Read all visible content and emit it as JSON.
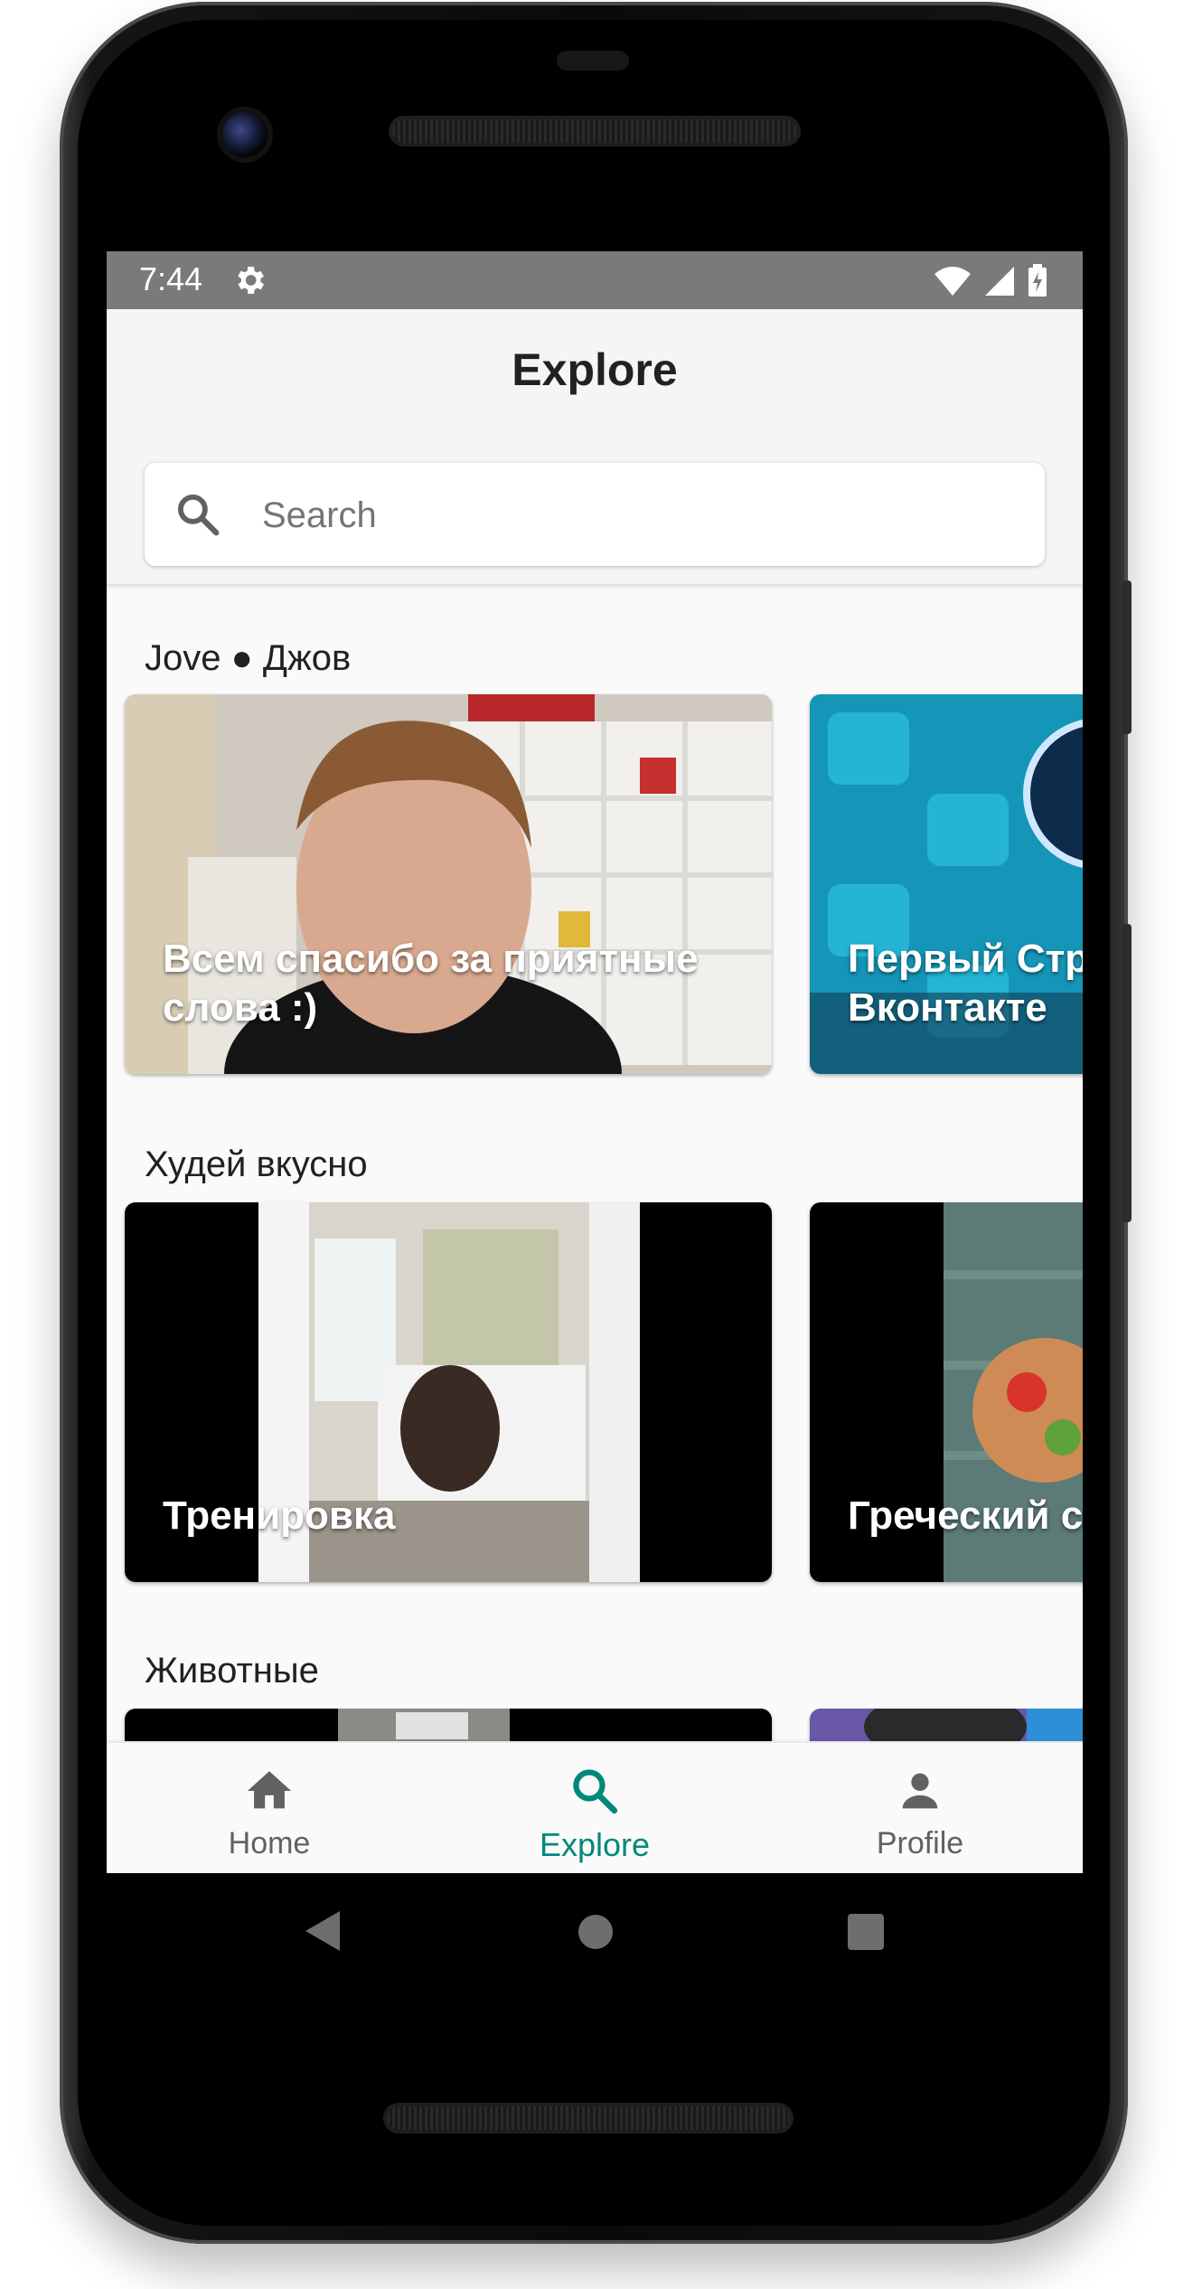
{
  "status_bar": {
    "time": "7:44"
  },
  "header": {
    "title": "Explore"
  },
  "search": {
    "placeholder": "Search",
    "value": ""
  },
  "sections": [
    {
      "title": "Jove ● Джов",
      "cards": [
        {
          "title": "Всем спасибо за приятные\nслова :)"
        },
        {
          "title": "Первый Стр\nВконтакте"
        }
      ]
    },
    {
      "title": "Худей вкусно",
      "cards": [
        {
          "title": "Тренировка"
        },
        {
          "title": "Греческий с"
        }
      ]
    },
    {
      "title": "Животные",
      "cards": [
        {
          "title": ""
        },
        {
          "title": ""
        }
      ]
    }
  ],
  "bottom_nav": {
    "items": [
      {
        "label": "Home",
        "icon": "home-icon"
      },
      {
        "label": "Explore",
        "icon": "search-icon"
      },
      {
        "label": "Profile",
        "icon": "person-icon"
      }
    ],
    "active_index": 1
  },
  "colors": {
    "accent": "#00897b",
    "inactive_nav": "#616161",
    "status_bar": "#7a7a7a",
    "background": "#fafafa"
  }
}
